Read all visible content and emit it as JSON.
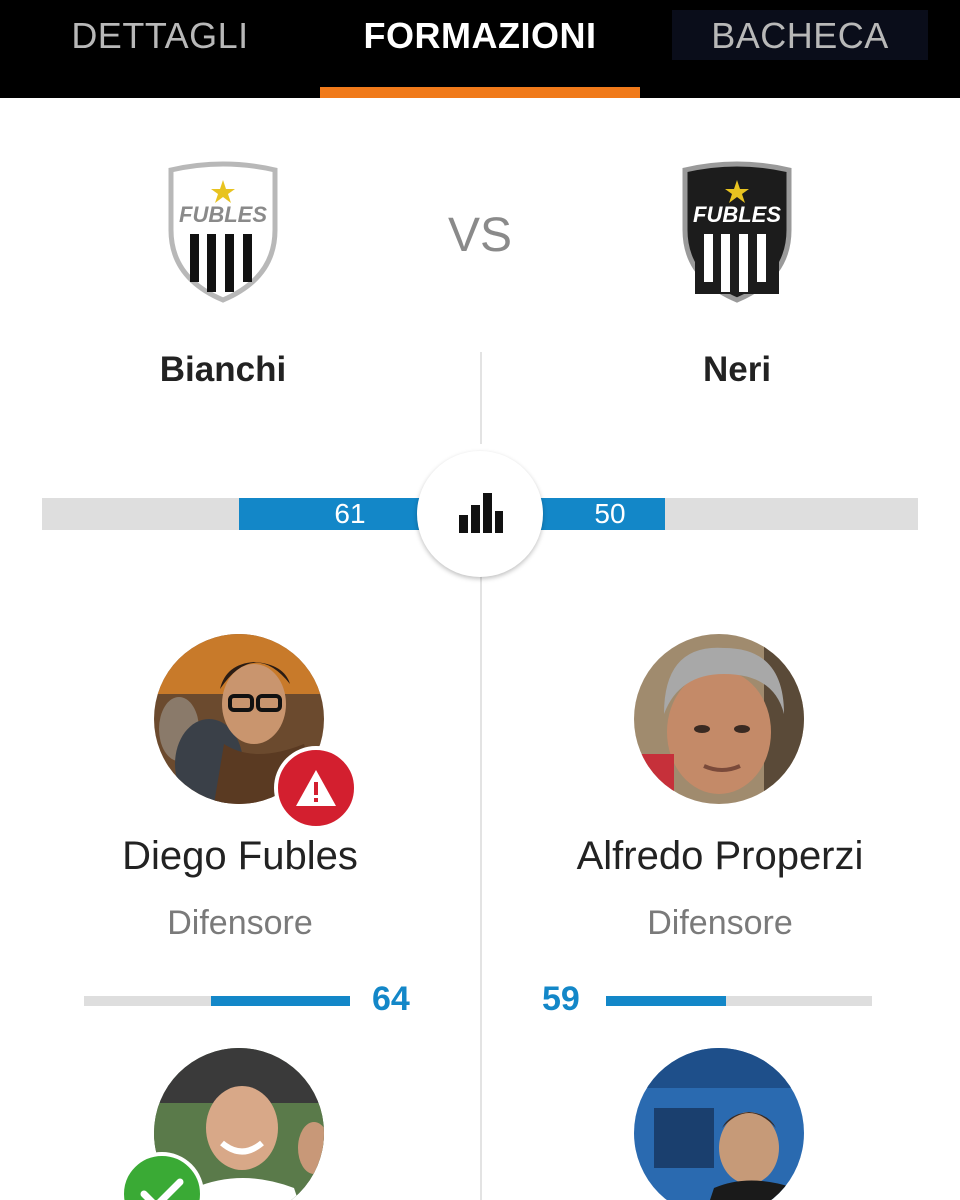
{
  "tabs": [
    {
      "label": "DETTAGLI",
      "active": false
    },
    {
      "label": "FORMAZIONI",
      "active": true
    },
    {
      "label": "BACHECA",
      "active": false
    }
  ],
  "colors": {
    "accent_orange": "#f07a1a",
    "bar_blue": "#1387c8",
    "warning_red": "#d31f2f",
    "ok_green": "#3aaa35"
  },
  "match": {
    "vs_label": "VS",
    "home": {
      "name": "Bianchi",
      "shield_text": "FUBLES",
      "shield_style": "white",
      "rating": "61",
      "rating_fraction": 0.208
    },
    "away": {
      "name": "Neri",
      "shield_text": "FUBLES",
      "shield_style": "black",
      "rating": "50",
      "rating_fraction": 0.144
    },
    "stats_icon": "bar-chart-icon"
  },
  "players": {
    "home": [
      {
        "name": "Diego Fubles",
        "role": "Difensore",
        "score": "64",
        "score_fraction": 0.52,
        "status_icon": "warning-icon"
      },
      {
        "status_icon": "check-icon"
      }
    ],
    "away": [
      {
        "name": "Alfredo Properzi",
        "role": "Difensore",
        "score": "59",
        "score_fraction": 0.45
      },
      {
        "status_icon": "none"
      }
    ]
  }
}
